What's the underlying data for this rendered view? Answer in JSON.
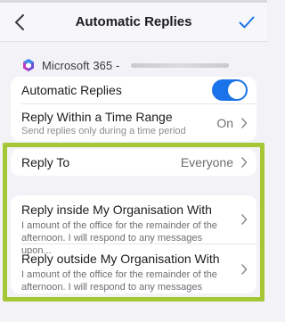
{
  "nav": {
    "title": "Automatic Replies"
  },
  "account": {
    "name": "Microsoft 365 -"
  },
  "settings": {
    "automatic_replies": {
      "label": "Automatic Replies",
      "enabled": true
    },
    "time_range": {
      "label": "Reply Within a Time Range",
      "subtitle": "Send replies only during a time period",
      "value": "On"
    },
    "reply_to": {
      "label": "Reply To",
      "value": "Everyone"
    },
    "inside": {
      "label": "Reply inside My Organisation With",
      "preview_line1": "I amount of the office for the remainder of the",
      "preview_line2": "afternoon. I will respond to any messages upon..."
    },
    "outside": {
      "label": "Reply outside My Organisation With",
      "preview_line1": "I amount of the office for the remainder of the",
      "preview_line2": "afternoon. I will respond to any messages upon..."
    }
  },
  "colors": {
    "toggle_on": "#1a73e8",
    "highlight_border": "#a6c735",
    "accent": "#1a73e8"
  }
}
